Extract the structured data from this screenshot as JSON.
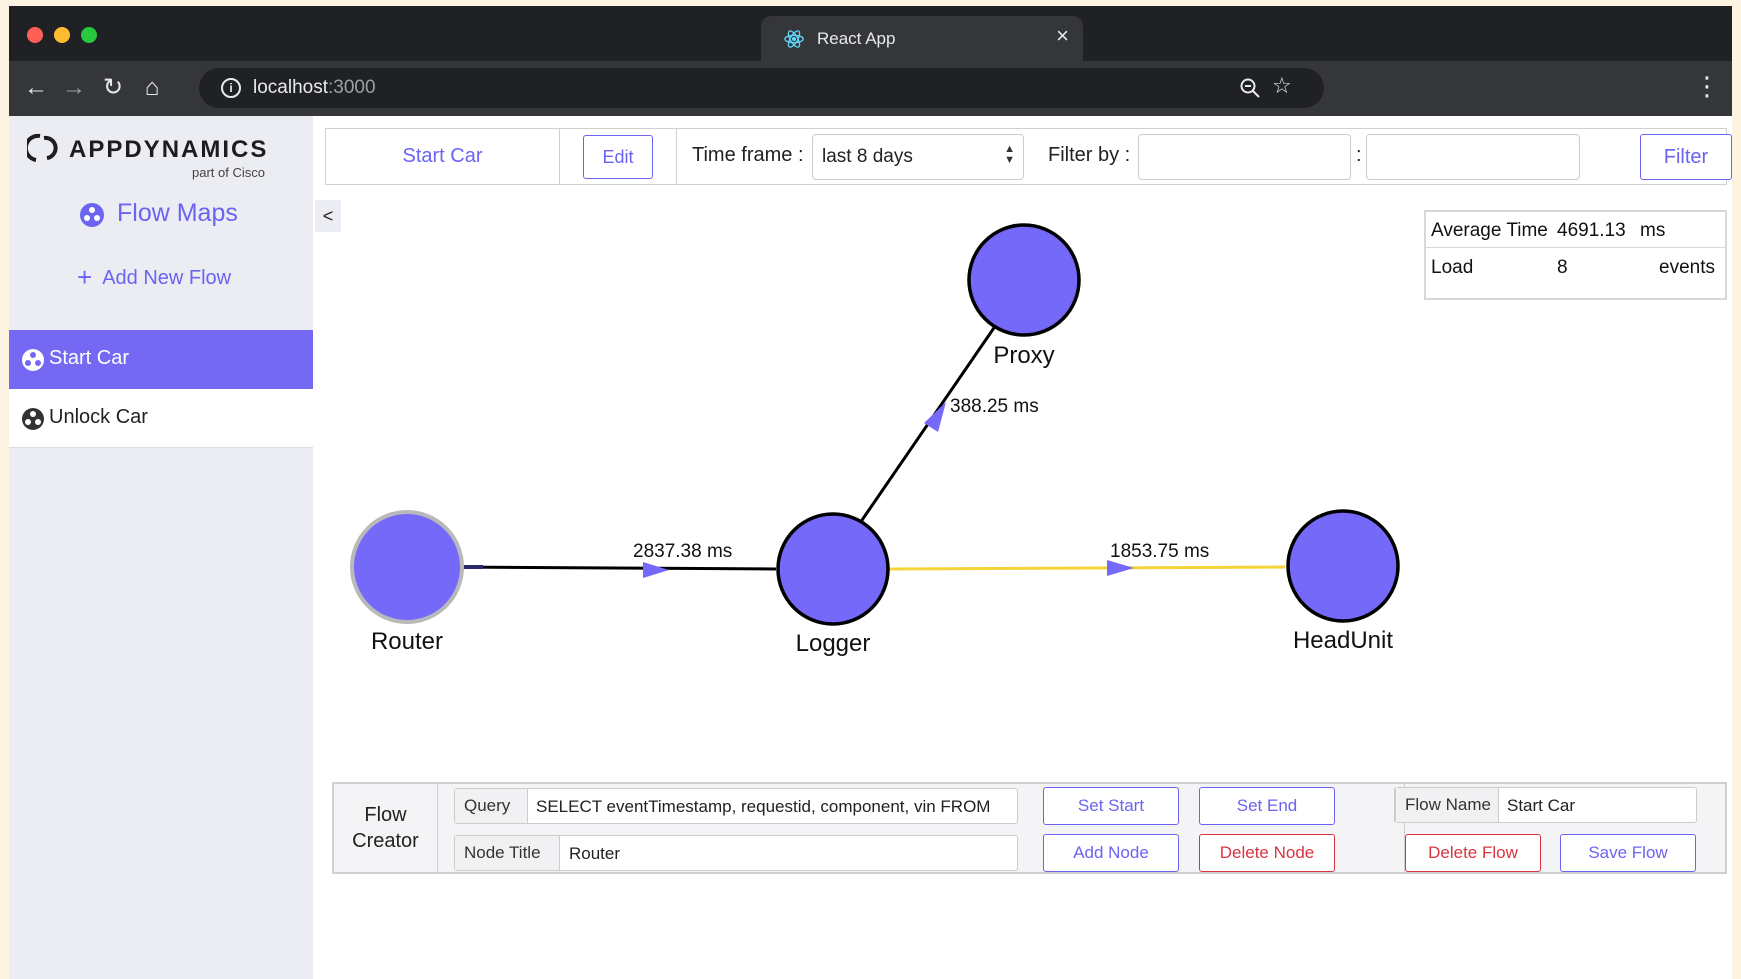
{
  "browser": {
    "tab_title": "React App",
    "tab_close": "×",
    "url_host": "localhost",
    "url_port": ":3000"
  },
  "sidebar": {
    "logo_text": "APPDYNAMICS",
    "logo_sub": "part of Cisco",
    "section_title": "Flow Maps",
    "add_label": "Add New Flow",
    "flows": [
      {
        "label": "Start Car",
        "active": true
      },
      {
        "label": "Unlock Car",
        "active": false
      }
    ],
    "collapse": "<"
  },
  "topbar": {
    "flow_name": "Start Car",
    "edit_label": "Edit",
    "timeframe_label": "Time frame :",
    "timeframe_value": "last 8 days",
    "filter_by_label": "Filter by :",
    "filter_sep": ":",
    "filter_key": "",
    "filter_value": "",
    "filter_button": "Filter"
  },
  "stats": {
    "avg_label": "Average Time",
    "avg_value": "4691.13",
    "avg_unit": "ms",
    "load_label": "Load",
    "load_value": "8",
    "load_unit": "events"
  },
  "graph": {
    "nodes": [
      "Router",
      "Logger",
      "Proxy",
      "HeadUnit"
    ],
    "edges": [
      {
        "from": "Router",
        "to": "Logger",
        "label": "2837.38 ms",
        "color": "#000000"
      },
      {
        "from": "Logger",
        "to": "Proxy",
        "label": "388.25 ms",
        "color": "#000000"
      },
      {
        "from": "Logger",
        "to": "HeadUnit",
        "label": "1853.75 ms",
        "color": "#f5d43a"
      }
    ],
    "node_color": "#7569f9",
    "arrow_color": "#7569f9"
  },
  "creator": {
    "title_line1": "Flow",
    "title_line2": "Creator",
    "query_label": "Query",
    "query_value": "SELECT eventTimestamp, requestid, component, vin FROM",
    "node_title_label": "Node Title",
    "node_title_value": "Router",
    "set_start": "Set Start",
    "set_end": "Set End",
    "add_node": "Add Node",
    "delete_node": "Delete Node",
    "flow_name_label": "Flow Name",
    "flow_name_value": "Start Car",
    "delete_flow": "Delete Flow",
    "save_flow": "Save Flow"
  },
  "colors": {
    "accent": "#6b63f2",
    "danger": "#d9333f",
    "active_item": "#7569f3"
  }
}
